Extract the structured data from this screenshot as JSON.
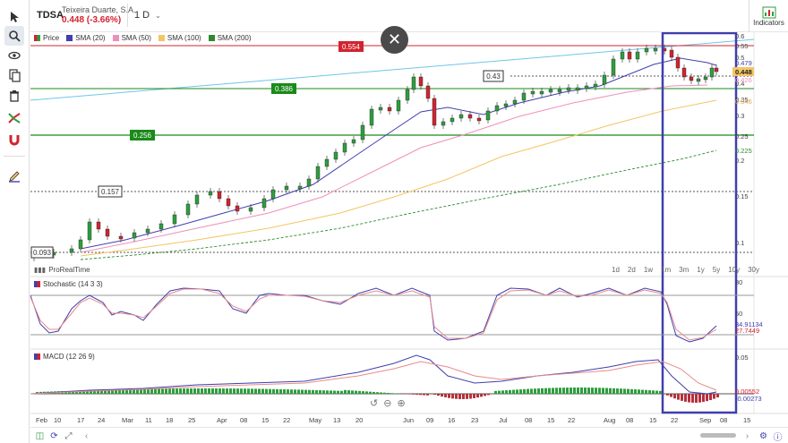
{
  "header": {
    "ticker": "TDSA",
    "company": "Teixeira Duarte, S.A.",
    "price_change": "0.448 (-3.66%)",
    "period": "1 D",
    "indicators_label": "Indicators"
  },
  "legend": [
    {
      "label": "Price",
      "color": "#d1242f"
    },
    {
      "label": "SMA (20)",
      "color": "#3f3fb0"
    },
    {
      "label": "SMA (50)",
      "color": "#ef8fb9"
    },
    {
      "label": "SMA (100)",
      "color": "#f3c565"
    },
    {
      "label": "SMA (200)",
      "color": "#2e8a2e"
    }
  ],
  "levels": {
    "l554": "0.554",
    "l43": "0.43",
    "l386": "0.386",
    "l256": "0.256",
    "l157": "0.157",
    "l093": "0.093"
  },
  "price_axis": {
    "ticks": [
      "0.6",
      "0.55",
      "0.5",
      "0.4",
      "0.35",
      "0.3",
      "0.25",
      "0.2",
      "0.15",
      "0.1"
    ],
    "tag_479": "0.479",
    "tag_448": "0.448",
    "tag_426": "0.426",
    "tag_346": "0.346",
    "tag_225": "0.225"
  },
  "branding": {
    "logo_text": "ProRealTime"
  },
  "timeframes": [
    "1d",
    "2d",
    "1w",
    "1m",
    "3m",
    "1y",
    "5y",
    "10y",
    "30y"
  ],
  "stochastic": {
    "title": "Stochastic (14 3 3)",
    "ticks": [
      "80",
      "50"
    ],
    "value1": "34.91134",
    "value2": "27.7449"
  },
  "macd": {
    "title": "MACD (12 26 9)",
    "tick": "0.05",
    "value1": "0.00552",
    "value2": "-0.00273"
  },
  "x_axis": [
    "Feb",
    "10",
    "17",
    "24",
    "Mar",
    "11",
    "18",
    "25",
    "Apr",
    "08",
    "15",
    "22",
    "May",
    "13",
    "20",
    "Jun",
    "09",
    "16",
    "23",
    "Jul",
    "08",
    "15",
    "22",
    "Aug",
    "08",
    "15",
    "22",
    "Sep",
    "08",
    "15"
  ],
  "colors": {
    "up": "#2e9e3e",
    "down": "#d1242f",
    "highlight_box": "#3f3fb0",
    "resistance": "#d1242f",
    "support": "#1a8a1a",
    "trendline": "#6ec6e8"
  }
}
